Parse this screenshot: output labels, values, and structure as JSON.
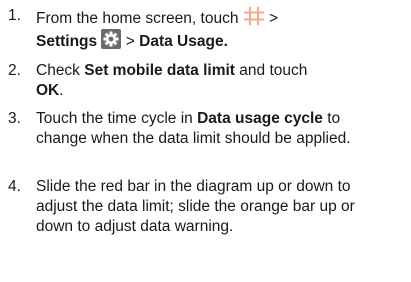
{
  "steps": [
    {
      "number": "1.",
      "line1": "From the home screen, touch",
      "gt1": ">",
      "settings": "Settings",
      "gt2": ">",
      "data_usage": "Data Usage."
    },
    {
      "number": "2.",
      "check": "Check",
      "set_limit": "Set mobile data limit",
      "and_touch": "and touch",
      "ok": "OK",
      "period": "."
    },
    {
      "number": "3.",
      "touch_time": "Touch the time cycle in",
      "cycle": "Data usage cycle",
      "rest": "to change when the data limit should be applied."
    },
    {
      "number": "4.",
      "text": "Slide the red bar in the diagram up or down to adjust the data limit; slide the orange bar up or down to adjust data warning."
    }
  ],
  "icons": {
    "apps": "apps-grid-icon",
    "settings": "settings-gear-icon"
  },
  "colors": {
    "text": "#1a1a1a",
    "apps_icon": "#f2a98a",
    "settings_icon_bg": "#6b6b6b"
  }
}
